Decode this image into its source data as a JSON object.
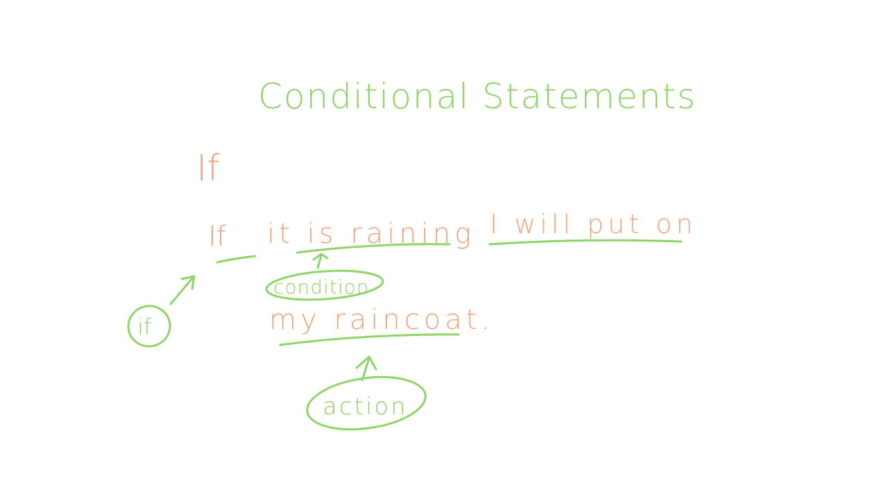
{
  "colors": {
    "green_ink": "#8fd468",
    "orange_ink": "#f2a37a",
    "background": "#ffffff"
  },
  "title": "Conditional Statements",
  "keyword": "If",
  "sentence": {
    "if_word": "If",
    "condition_text": "it is raining",
    "action_line1": "I will put on",
    "action_line2": "my raincoat."
  },
  "annotations": {
    "if_label": "if",
    "condition_label": "condition",
    "action_label": "action"
  }
}
